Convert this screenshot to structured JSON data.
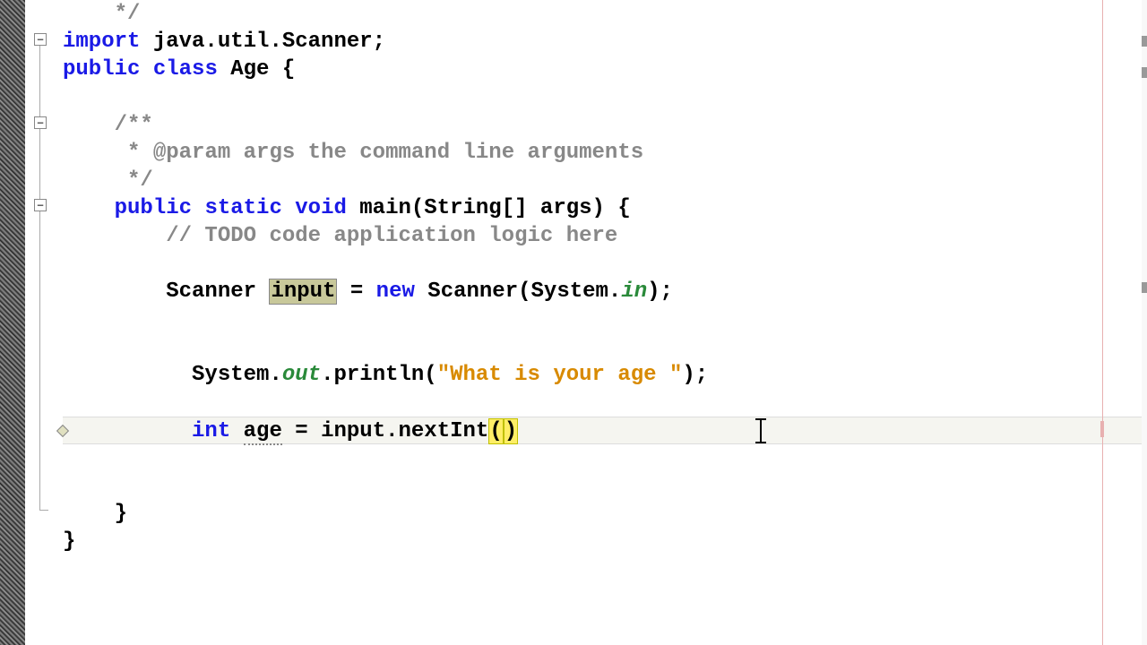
{
  "code": {
    "line1": "    */",
    "line2": {
      "kw1": "import",
      "rest": " java.util.Scanner;"
    },
    "line3": {
      "kw1": "public",
      "kw2": "class",
      "name": "Age",
      "brace": " {"
    },
    "line4": "",
    "line5": "    /**",
    "line6_a": "     * ",
    "line6_b": "@param",
    "line6_c": " args the command line arguments",
    "line7": "     */",
    "line8": {
      "kw1": "public",
      "kw2": "static",
      "kw3": "void",
      "name": "main",
      "params": "(String[] args) {"
    },
    "line9": "        // TODO code application logic here",
    "line10": "",
    "line11": {
      "indent": "        ",
      "type": "Scanner ",
      "var": "input",
      "eq": " = ",
      "new": "new",
      "rest1": " Scanner(System.",
      "in": "in",
      "rest2": ");"
    },
    "line12": "",
    "line13": "",
    "line14": {
      "indent": "          ",
      "sys": "System.",
      "out": "out",
      "dot": ".println(",
      "str": "\"What is your age \"",
      "end": ");"
    },
    "line15": "",
    "line16": {
      "indent": "          ",
      "type": "int",
      "sp": " ",
      "var": "age",
      "eq": " = input.nextInt",
      "p1": "(",
      "p2": ")"
    },
    "line17": "",
    "line18": "",
    "line19": "    }",
    "line20": "}"
  }
}
